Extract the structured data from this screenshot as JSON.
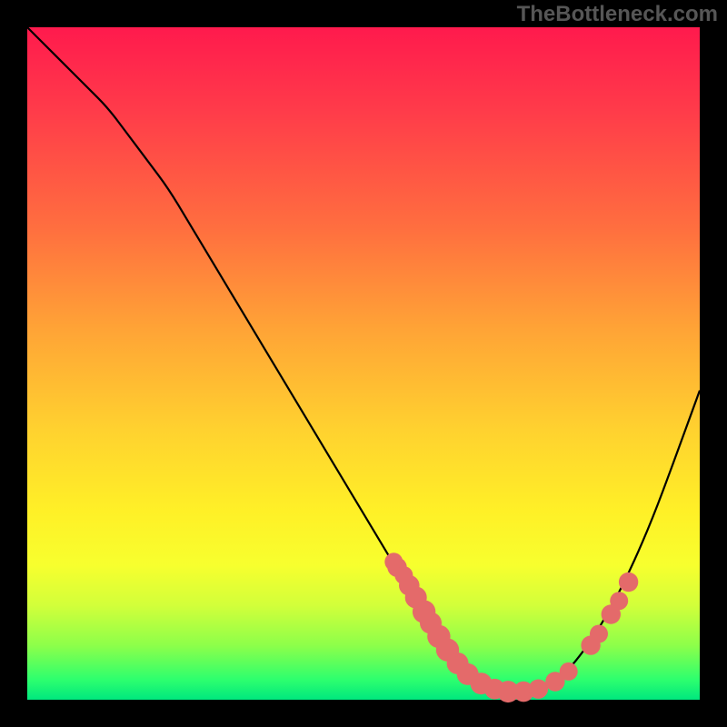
{
  "watermark": "TheBottleneck.com",
  "colors": {
    "background": "#000000",
    "marker": "#e46a6a",
    "curve": "#000000",
    "gradient_stops": [
      "#ff1a4d",
      "#ff3a4a",
      "#ff6f3f",
      "#ffa436",
      "#ffd22f",
      "#fff027",
      "#f7ff2e",
      "#d2ff3a",
      "#8cff4a",
      "#2dff6e",
      "#00e77e"
    ]
  },
  "chart_data": {
    "type": "line",
    "title": "",
    "xlabel": "",
    "ylabel": "",
    "xlim": [
      0,
      100
    ],
    "ylim": [
      0,
      100
    ],
    "series": [
      {
        "name": "bottleneck-curve",
        "x": [
          0,
          3,
          6,
          9,
          12,
          15,
          18,
          21,
          24,
          27,
          30,
          33,
          36,
          39,
          42,
          45,
          48,
          51,
          54,
          57,
          60,
          63,
          66,
          69,
          72,
          75,
          78,
          81,
          84,
          87,
          90,
          93,
          96,
          100
        ],
        "values": [
          100,
          97,
          94,
          91,
          88,
          84,
          80,
          76,
          71,
          66,
          61,
          56,
          51,
          46,
          41,
          36,
          31,
          26,
          21,
          16,
          11,
          7,
          4,
          2,
          1,
          1,
          2,
          5,
          9,
          14,
          20,
          27,
          35,
          46
        ]
      }
    ],
    "markers": [
      {
        "x": 54.5,
        "y": 20.5,
        "r": 0.9
      },
      {
        "x": 55.0,
        "y": 19.7,
        "r": 1.0
      },
      {
        "x": 56.0,
        "y": 18.5,
        "r": 0.9
      },
      {
        "x": 56.8,
        "y": 17.0,
        "r": 1.1
      },
      {
        "x": 57.8,
        "y": 15.2,
        "r": 1.2
      },
      {
        "x": 59.0,
        "y": 13.1,
        "r": 1.3
      },
      {
        "x": 60.0,
        "y": 11.4,
        "r": 1.2
      },
      {
        "x": 61.2,
        "y": 9.4,
        "r": 1.3
      },
      {
        "x": 62.5,
        "y": 7.4,
        "r": 1.3
      },
      {
        "x": 64.0,
        "y": 5.4,
        "r": 1.2
      },
      {
        "x": 65.5,
        "y": 3.8,
        "r": 1.2
      },
      {
        "x": 67.5,
        "y": 2.4,
        "r": 1.2
      },
      {
        "x": 69.5,
        "y": 1.6,
        "r": 1.1
      },
      {
        "x": 71.5,
        "y": 1.2,
        "r": 1.2
      },
      {
        "x": 73.8,
        "y": 1.2,
        "r": 1.1
      },
      {
        "x": 76.0,
        "y": 1.6,
        "r": 1.0
      },
      {
        "x": 78.5,
        "y": 2.7,
        "r": 1.0
      },
      {
        "x": 80.5,
        "y": 4.2,
        "r": 0.9
      },
      {
        "x": 83.8,
        "y": 8.1,
        "r": 1.0
      },
      {
        "x": 85.0,
        "y": 9.8,
        "r": 0.9
      },
      {
        "x": 86.8,
        "y": 12.7,
        "r": 1.0
      },
      {
        "x": 88.0,
        "y": 14.7,
        "r": 0.9
      },
      {
        "x": 89.4,
        "y": 17.5,
        "r": 1.0
      }
    ]
  }
}
